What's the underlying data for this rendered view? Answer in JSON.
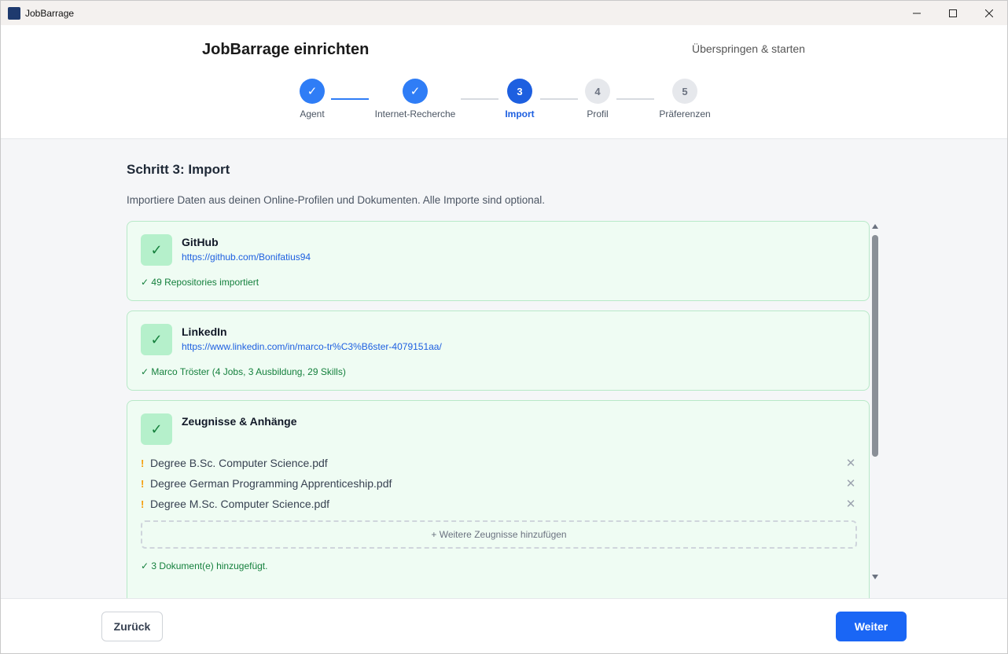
{
  "window": {
    "title": "JobBarrage"
  },
  "header": {
    "title": "JobBarrage einrichten",
    "skip_label": "Überspringen & starten"
  },
  "steps": [
    {
      "label": "Agent",
      "marker": "✓",
      "state": "done"
    },
    {
      "label": "Internet-Recherche",
      "marker": "✓",
      "state": "done"
    },
    {
      "label": "Import",
      "marker": "3",
      "state": "active"
    },
    {
      "label": "Profil",
      "marker": "4",
      "state": "todo"
    },
    {
      "label": "Präferenzen",
      "marker": "5",
      "state": "todo"
    }
  ],
  "main": {
    "title": "Schritt 3: Import",
    "description": "Importiere Daten aus deinen Online-Profilen und Dokumenten. Alle Importe sind optional.",
    "cards": {
      "github": {
        "check": "✓",
        "title": "GitHub",
        "url": "https://github.com/Bonifatius94",
        "status": "✓ 49 Repositories importiert"
      },
      "linkedin": {
        "check": "✓",
        "title": "LinkedIn",
        "url": "https://www.linkedin.com/in/marco-tr%C3%B6ster-4079151aa/",
        "status": "✓ Marco Tröster (4 Jobs, 3 Ausbildung, 29 Skills)"
      },
      "documents": {
        "check": "✓",
        "title": "Zeugnisse & Anhänge",
        "files": [
          {
            "warn": "!",
            "name": "Degree B.Sc. Computer Science.pdf",
            "remove": "✕"
          },
          {
            "warn": "!",
            "name": "Degree German Programming Apprenticeship.pdf",
            "remove": "✕"
          },
          {
            "warn": "!",
            "name": "Degree M.Sc. Computer Science.pdf",
            "remove": "✕"
          }
        ],
        "add_more_label": "+ Weitere Zeugnisse hinzufügen",
        "status": "✓ 3 Dokument(e) hinzugefügt."
      }
    }
  },
  "footer": {
    "back_label": "Zurück",
    "next_label": "Weiter"
  },
  "colors": {
    "accent": "#1a66f5",
    "success": "#15803d",
    "warning": "#f59e0b"
  }
}
